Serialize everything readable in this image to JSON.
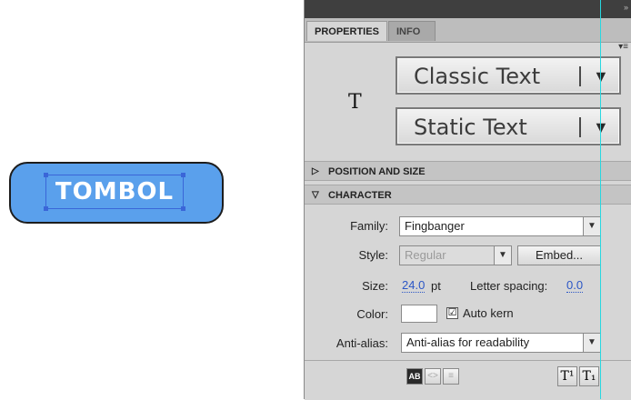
{
  "stage": {
    "button_text": "TOMBOL",
    "button_color": "#5aa0ec"
  },
  "panel": {
    "tabs": [
      "PROPERTIES",
      "INFO"
    ],
    "tool_icon": "T",
    "text_engine": "Classic Text",
    "text_type": "Static Text",
    "sections": {
      "position_size": "POSITION AND SIZE",
      "character": "CHARACTER"
    },
    "character": {
      "family_label": "Family:",
      "family_value": "Fingbanger",
      "style_label": "Style:",
      "style_value": "Regular",
      "embed_label": "Embed...",
      "size_label": "Size:",
      "size_value": "24.0",
      "size_unit": "pt",
      "letter_spacing_label": "Letter spacing:",
      "letter_spacing_value": "0.0",
      "color_label": "Color:",
      "auto_kern_label": "Auto kern",
      "auto_kern_checked": "☑",
      "anti_alias_label": "Anti-alias:",
      "anti_alias_value": "Anti-alias for readability"
    },
    "bottom_icons": {
      "selectable": "AB",
      "html": "<>",
      "border": "≡",
      "superscript": "T¹",
      "subscript": "T₁"
    }
  }
}
